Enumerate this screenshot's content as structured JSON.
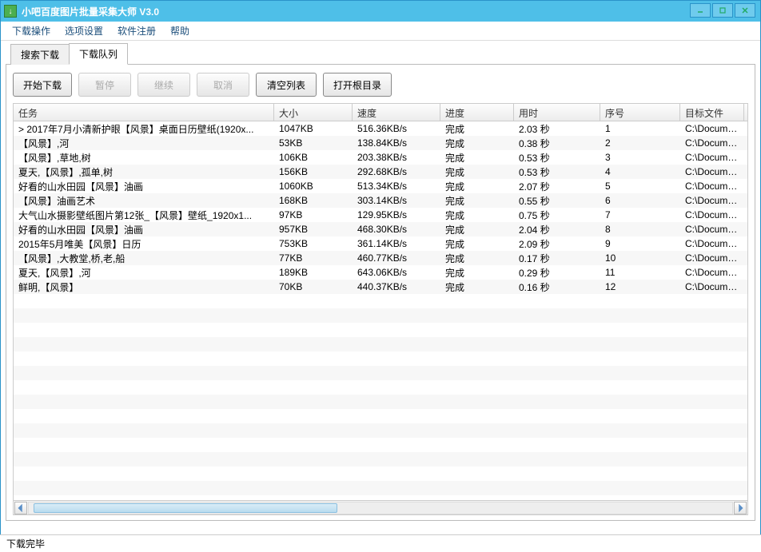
{
  "window": {
    "title": "小吧百度图片批量采集大师 V3.0"
  },
  "menu": {
    "download_ops": "下载操作",
    "options": "选项设置",
    "register": "软件注册",
    "help": "帮助"
  },
  "tabs": {
    "search": "搜索下载",
    "queue": "下载队列"
  },
  "toolbar": {
    "start": "开始下载",
    "pause": "暂停",
    "resume": "继续",
    "cancel": "取消",
    "clear": "清空列表",
    "open_root": "打开根目录"
  },
  "columns": {
    "task": "任务",
    "size": "大小",
    "speed": "速度",
    "progress": "进度",
    "time": "用时",
    "index": "序号",
    "target": "目标文件"
  },
  "rows": [
    {
      "task": "> 2017年7月小清新护眼【风景】桌面日历壁纸(1920x...",
      "size": "1047KB",
      "speed": "516.36KB/s",
      "progress": "完成",
      "time": "2.03 秒",
      "index": "1",
      "target": "C:\\Documents and"
    },
    {
      "task": "【风景】,河",
      "size": "53KB",
      "speed": "138.84KB/s",
      "progress": "完成",
      "time": "0.38 秒",
      "index": "2",
      "target": "C:\\Documents and"
    },
    {
      "task": "【风景】,草地,树",
      "size": "106KB",
      "speed": "203.38KB/s",
      "progress": "完成",
      "time": "0.53 秒",
      "index": "3",
      "target": "C:\\Documents and"
    },
    {
      "task": "夏天,【风景】,孤单,树",
      "size": "156KB",
      "speed": "292.68KB/s",
      "progress": "完成",
      "time": "0.53 秒",
      "index": "4",
      "target": "C:\\Documents and"
    },
    {
      "task": "好看的山水田园【风景】油画",
      "size": "1060KB",
      "speed": "513.34KB/s",
      "progress": "完成",
      "time": "2.07 秒",
      "index": "5",
      "target": "C:\\Documents and"
    },
    {
      "task": "【风景】油画艺术",
      "size": "168KB",
      "speed": "303.14KB/s",
      "progress": "完成",
      "time": "0.55 秒",
      "index": "6",
      "target": "C:\\Documents and"
    },
    {
      "task": "大气山水摄影壁纸图片第12张_【风景】壁纸_1920x1...",
      "size": "97KB",
      "speed": "129.95KB/s",
      "progress": "完成",
      "time": "0.75 秒",
      "index": "7",
      "target": "C:\\Documents and"
    },
    {
      "task": "好看的山水田园【风景】油画",
      "size": "957KB",
      "speed": "468.30KB/s",
      "progress": "完成",
      "time": "2.04 秒",
      "index": "8",
      "target": "C:\\Documents and"
    },
    {
      "task": "2015年5月唯美【风景】日历",
      "size": "753KB",
      "speed": "361.14KB/s",
      "progress": "完成",
      "time": "2.09 秒",
      "index": "9",
      "target": "C:\\Documents and"
    },
    {
      "task": "【风景】,大教堂,桥,老,船",
      "size": "77KB",
      "speed": "460.77KB/s",
      "progress": "完成",
      "time": "0.17 秒",
      "index": "10",
      "target": "C:\\Documents and"
    },
    {
      "task": "夏天,【风景】,河",
      "size": "189KB",
      "speed": "643.06KB/s",
      "progress": "完成",
      "time": "0.29 秒",
      "index": "11",
      "target": "C:\\Documents and"
    },
    {
      "task": "鲜明,【风景】",
      "size": "70KB",
      "speed": "440.37KB/s",
      "progress": "完成",
      "time": "0.16 秒",
      "index": "12",
      "target": "C:\\Documents and"
    }
  ],
  "status": {
    "text": "下载完毕"
  }
}
